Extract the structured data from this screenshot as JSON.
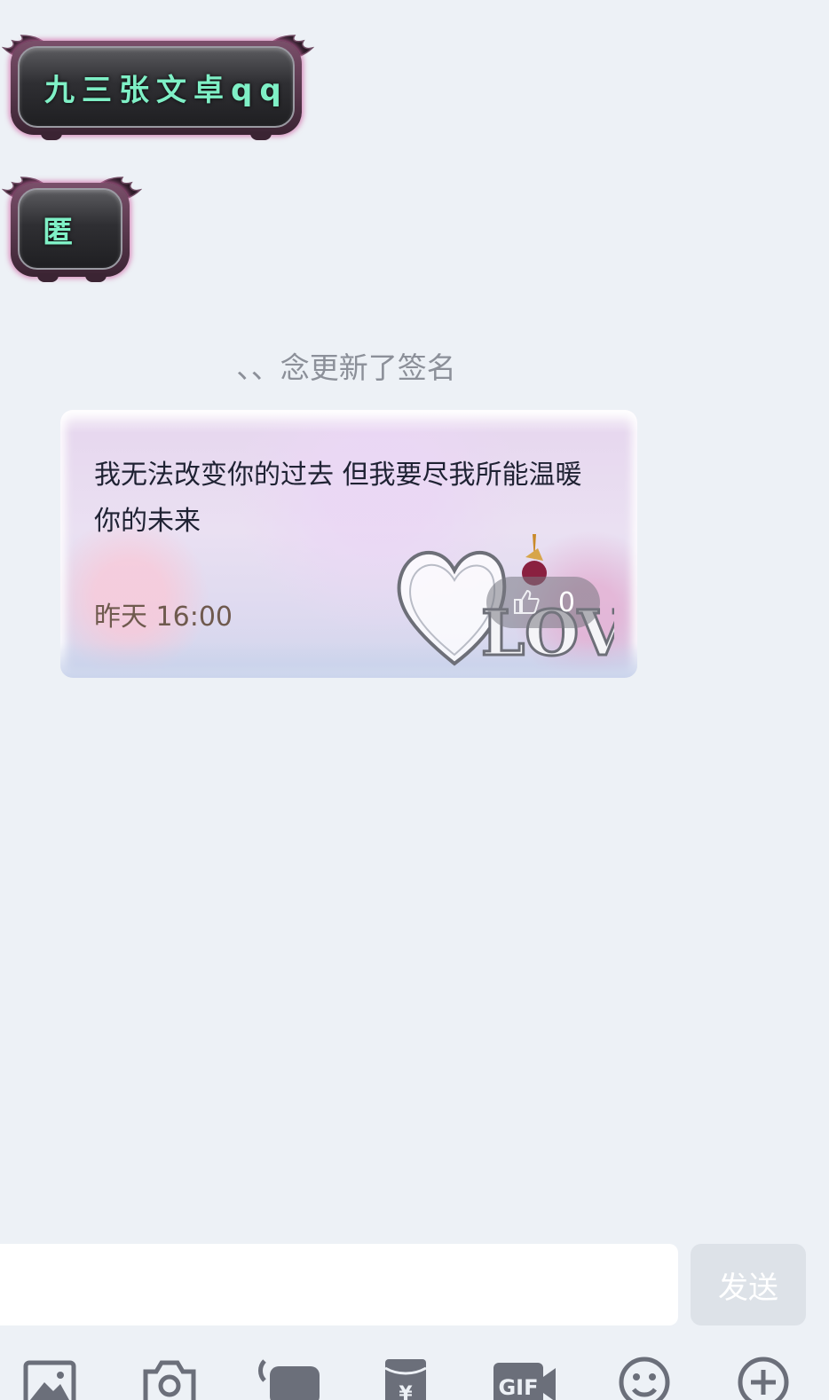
{
  "messages": {
    "bubble1_text": "九三张文卓qq",
    "bubble2_text": "匿"
  },
  "system_notice": "、、念更新了签名",
  "signature_card": {
    "text": "我无法改变你的过去  但我要尽我所能温暖你的未来",
    "time": "昨天 16:00",
    "like_count": "0",
    "art_word": "LOVE"
  },
  "input": {
    "value": "",
    "placeholder": "",
    "send_label": "发送"
  },
  "toolbar": {
    "items": [
      "image-icon",
      "camera-icon",
      "voice-icon",
      "red-packet-icon",
      "gif-icon",
      "emoji-icon",
      "plus-icon"
    ]
  },
  "colors": {
    "background": "#edf1f6",
    "bubble_text": "#7ff0c6",
    "notice_text": "#8c9099",
    "toolbar_icon": "#6b6f7a"
  }
}
